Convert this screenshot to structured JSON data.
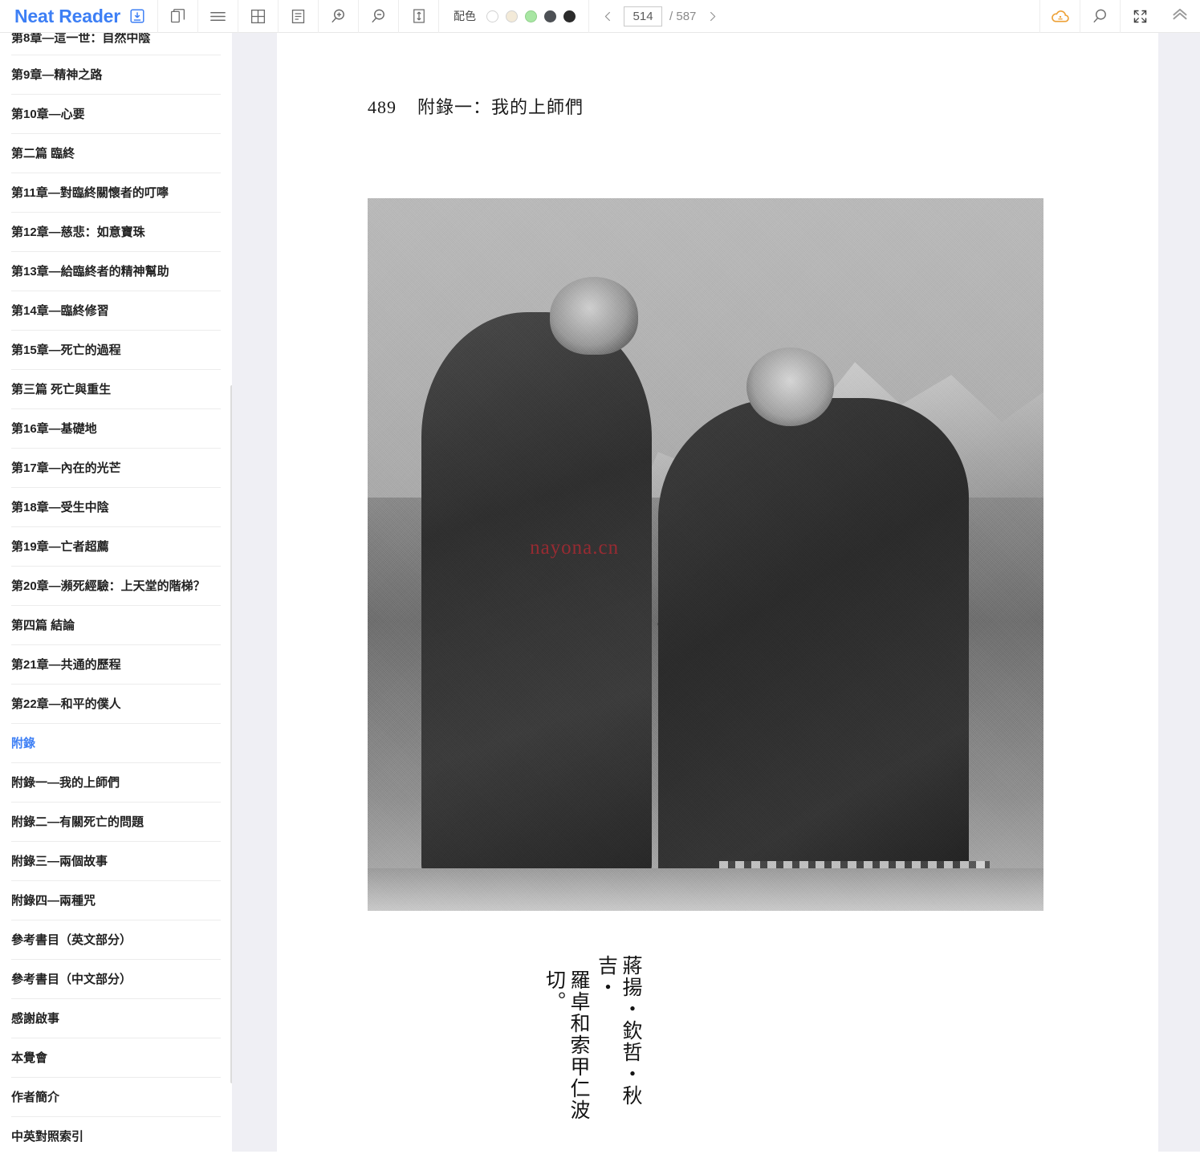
{
  "app": {
    "brand": "Neat Reader",
    "brand_color": "#3d7ff5",
    "save_icon": "save-download-icon"
  },
  "toolbar": {
    "buttons": [
      {
        "name": "library-icon",
        "title": "Library"
      },
      {
        "name": "contents-menu-icon",
        "title": "Contents"
      },
      {
        "name": "grid-layout-icon",
        "title": "Grid view"
      },
      {
        "name": "notes-panel-icon",
        "title": "Notes"
      },
      {
        "name": "zoom-in-icon",
        "title": "Zoom in"
      },
      {
        "name": "zoom-out-icon",
        "title": "Zoom out"
      },
      {
        "name": "fit-height-icon",
        "title": "Fit height"
      }
    ],
    "color_label": "配色",
    "color_swatches": [
      "#ffffff",
      "#f3ead8",
      "#a8e6a3",
      "#4d5055",
      "#2b2b2b"
    ],
    "pager": {
      "prev_icon": "chevron-left-icon",
      "next_icon": "chevron-right-icon",
      "current_page": "514",
      "total_label": "/ 587",
      "total_pages": "587"
    },
    "right_buttons": [
      {
        "name": "cloud-sync-icon",
        "title": "Cloud sync",
        "color": "#eda035"
      },
      {
        "name": "search-icon",
        "title": "Search",
        "color": "#6f6f6f"
      },
      {
        "name": "fullscreen-icon",
        "title": "Full screen",
        "color": "#4a4a4a"
      },
      {
        "name": "collapse-up-icon",
        "title": "Hide toolbar",
        "color": "#8a8a8a"
      }
    ]
  },
  "sidebar": {
    "active_color": "#3d7ff5",
    "items": [
      {
        "label": "第8章—這一世：自然中陰",
        "active": false,
        "clipped": true
      },
      {
        "label": "第9章—精神之路",
        "active": false
      },
      {
        "label": "第10章—心要",
        "active": false
      },
      {
        "label": "第二篇 臨終",
        "active": false
      },
      {
        "label": "第11章—對臨終關懷者的叮嚀",
        "active": false
      },
      {
        "label": "第12章—慈悲：如意寶珠",
        "active": false
      },
      {
        "label": "第13章—給臨終者的精神幫助",
        "active": false
      },
      {
        "label": "第14章—臨終修習",
        "active": false
      },
      {
        "label": "第15章—死亡的過程",
        "active": false
      },
      {
        "label": "第三篇 死亡與重生",
        "active": false
      },
      {
        "label": "第16章—基礎地",
        "active": false
      },
      {
        "label": "第17章—內在的光芒",
        "active": false
      },
      {
        "label": "第18章—受生中陰",
        "active": false
      },
      {
        "label": "第19章—亡者超薦",
        "active": false
      },
      {
        "label": "第20章—瀕死經驗：上天堂的階梯？",
        "active": false
      },
      {
        "label": "第四篇 結論",
        "active": false
      },
      {
        "label": "第21章—共通的歷程",
        "active": false
      },
      {
        "label": "第22章—和平的僕人",
        "active": false
      },
      {
        "label": "附錄",
        "active": true
      },
      {
        "label": "附錄一—我的上師們",
        "active": false
      },
      {
        "label": "附錄二—有關死亡的問題",
        "active": false
      },
      {
        "label": "附錄三—兩個故事",
        "active": false
      },
      {
        "label": "附錄四—兩種咒",
        "active": false
      },
      {
        "label": "參考書目（英文部分）",
        "active": false
      },
      {
        "label": "參考書目（中文部分）",
        "active": false
      },
      {
        "label": "感謝啟事",
        "active": false
      },
      {
        "label": "本覺會",
        "active": false
      },
      {
        "label": "作者簡介",
        "active": false
      },
      {
        "label": "中英對照索引",
        "active": false
      }
    ]
  },
  "page": {
    "page_number": "489",
    "running_head": "附錄一：我的上師們",
    "figure": {
      "name": "photo-two-lamas",
      "watermark": "nayona.cn",
      "caption_col1": "蔣揚・欽哲・秋吉・",
      "caption_col2": "羅卓和索甲仁波切。"
    }
  }
}
